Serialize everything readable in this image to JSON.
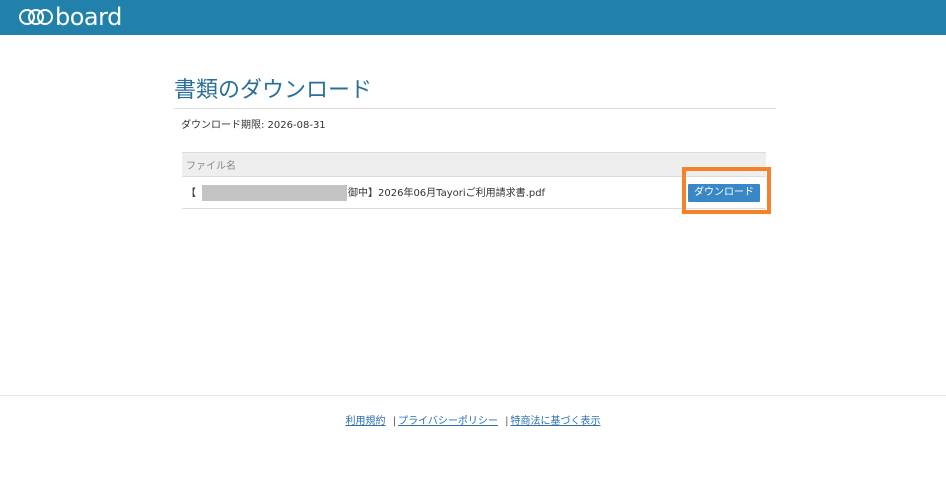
{
  "header": {
    "logo_text": "board",
    "bar_color": "#2181ab"
  },
  "main": {
    "title": "書類のダウンロード",
    "deadline": "ダウンロード期限: 2026-08-31",
    "table": {
      "column_header": "ファイル名",
      "rows": [
        {
          "prefix": "【",
          "filename_suffix": "御中】2026年06月Tayoriご利用請求書.pdf",
          "button_label": "ダウンロード"
        }
      ]
    }
  },
  "footer": {
    "links": [
      "利用規約",
      "プライバシーポリシー",
      "特商法に基づく表示"
    ],
    "separator": "|"
  },
  "colors": {
    "accent": "#3a87c8",
    "highlight": "#f5822b",
    "title": "#2a6f97"
  }
}
